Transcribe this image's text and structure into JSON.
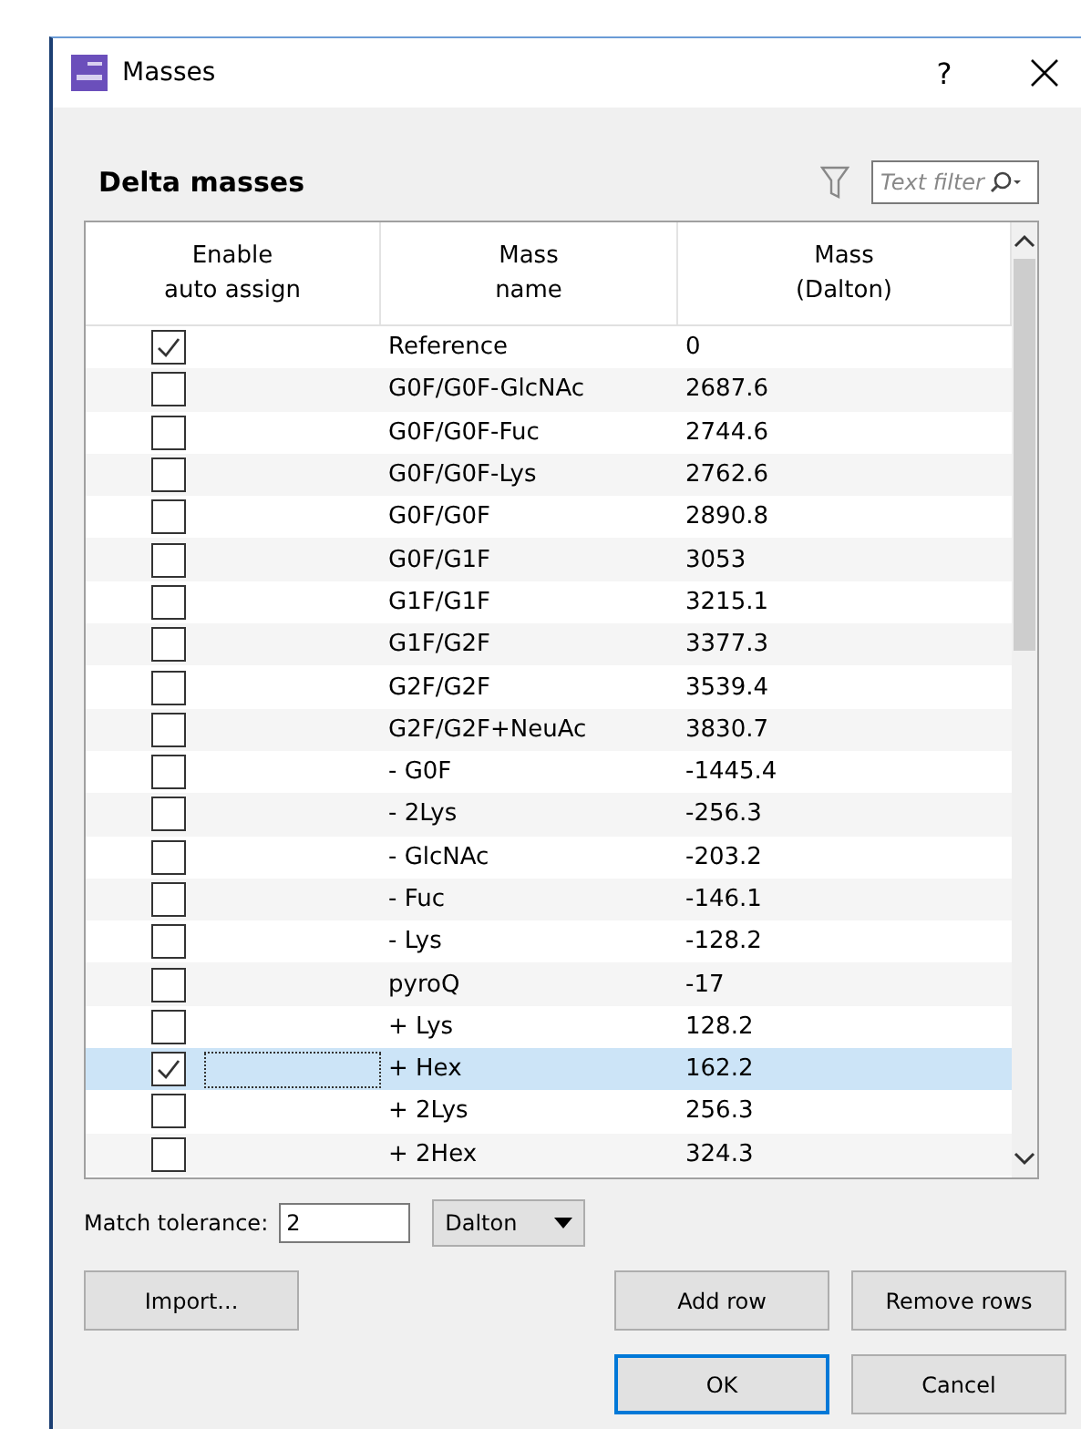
{
  "window": {
    "title": "Masses",
    "help": "?"
  },
  "section_title": "Delta masses",
  "filter": {
    "placeholder": "Text filter"
  },
  "table": {
    "columns": [
      "Enable\nauto assign",
      "Mass\nname",
      "Mass\n(Dalton)"
    ],
    "rows": [
      {
        "enabled": true,
        "name": "Reference",
        "mass": "0",
        "selected": false
      },
      {
        "enabled": false,
        "name": "G0F/G0F-GlcNAc",
        "mass": "2687.6",
        "selected": false
      },
      {
        "enabled": false,
        "name": "G0F/G0F-Fuc",
        "mass": "2744.6",
        "selected": false
      },
      {
        "enabled": false,
        "name": "G0F/G0F-Lys",
        "mass": "2762.6",
        "selected": false
      },
      {
        "enabled": false,
        "name": "G0F/G0F",
        "mass": "2890.8",
        "selected": false
      },
      {
        "enabled": false,
        "name": "G0F/G1F",
        "mass": "3053",
        "selected": false
      },
      {
        "enabled": false,
        "name": "G1F/G1F",
        "mass": "3215.1",
        "selected": false
      },
      {
        "enabled": false,
        "name": "G1F/G2F",
        "mass": "3377.3",
        "selected": false
      },
      {
        "enabled": false,
        "name": "G2F/G2F",
        "mass": "3539.4",
        "selected": false
      },
      {
        "enabled": false,
        "name": "G2F/G2F+NeuAc",
        "mass": "3830.7",
        "selected": false
      },
      {
        "enabled": false,
        "name": "- G0F",
        "mass": "-1445.4",
        "selected": false
      },
      {
        "enabled": false,
        "name": "- 2Lys",
        "mass": "-256.3",
        "selected": false
      },
      {
        "enabled": false,
        "name": "- GlcNAc",
        "mass": "-203.2",
        "selected": false
      },
      {
        "enabled": false,
        "name": "- Fuc",
        "mass": "-146.1",
        "selected": false
      },
      {
        "enabled": false,
        "name": "- Lys",
        "mass": "-128.2",
        "selected": false
      },
      {
        "enabled": false,
        "name": "pyroQ",
        "mass": "-17",
        "selected": false
      },
      {
        "enabled": false,
        "name": "+ Lys",
        "mass": "128.2",
        "selected": false
      },
      {
        "enabled": true,
        "name": "+ Hex",
        "mass": "162.2",
        "selected": true
      },
      {
        "enabled": false,
        "name": "+ 2Lys",
        "mass": "256.3",
        "selected": false
      },
      {
        "enabled": false,
        "name": "+ 2Hex",
        "mass": "324.3",
        "selected": false
      }
    ]
  },
  "tolerance": {
    "label": "Match tolerance:",
    "value": "2",
    "unit": "Dalton"
  },
  "buttons": [
    {
      "label": "Import...",
      "kind": "left"
    },
    {
      "label": "Add row",
      "kind": "right"
    },
    {
      "label": "Remove rows",
      "kind": "right"
    }
  ],
  "dialog_buttons": [
    {
      "label": "OK",
      "default": true
    },
    {
      "label": "Cancel",
      "default": false
    }
  ]
}
